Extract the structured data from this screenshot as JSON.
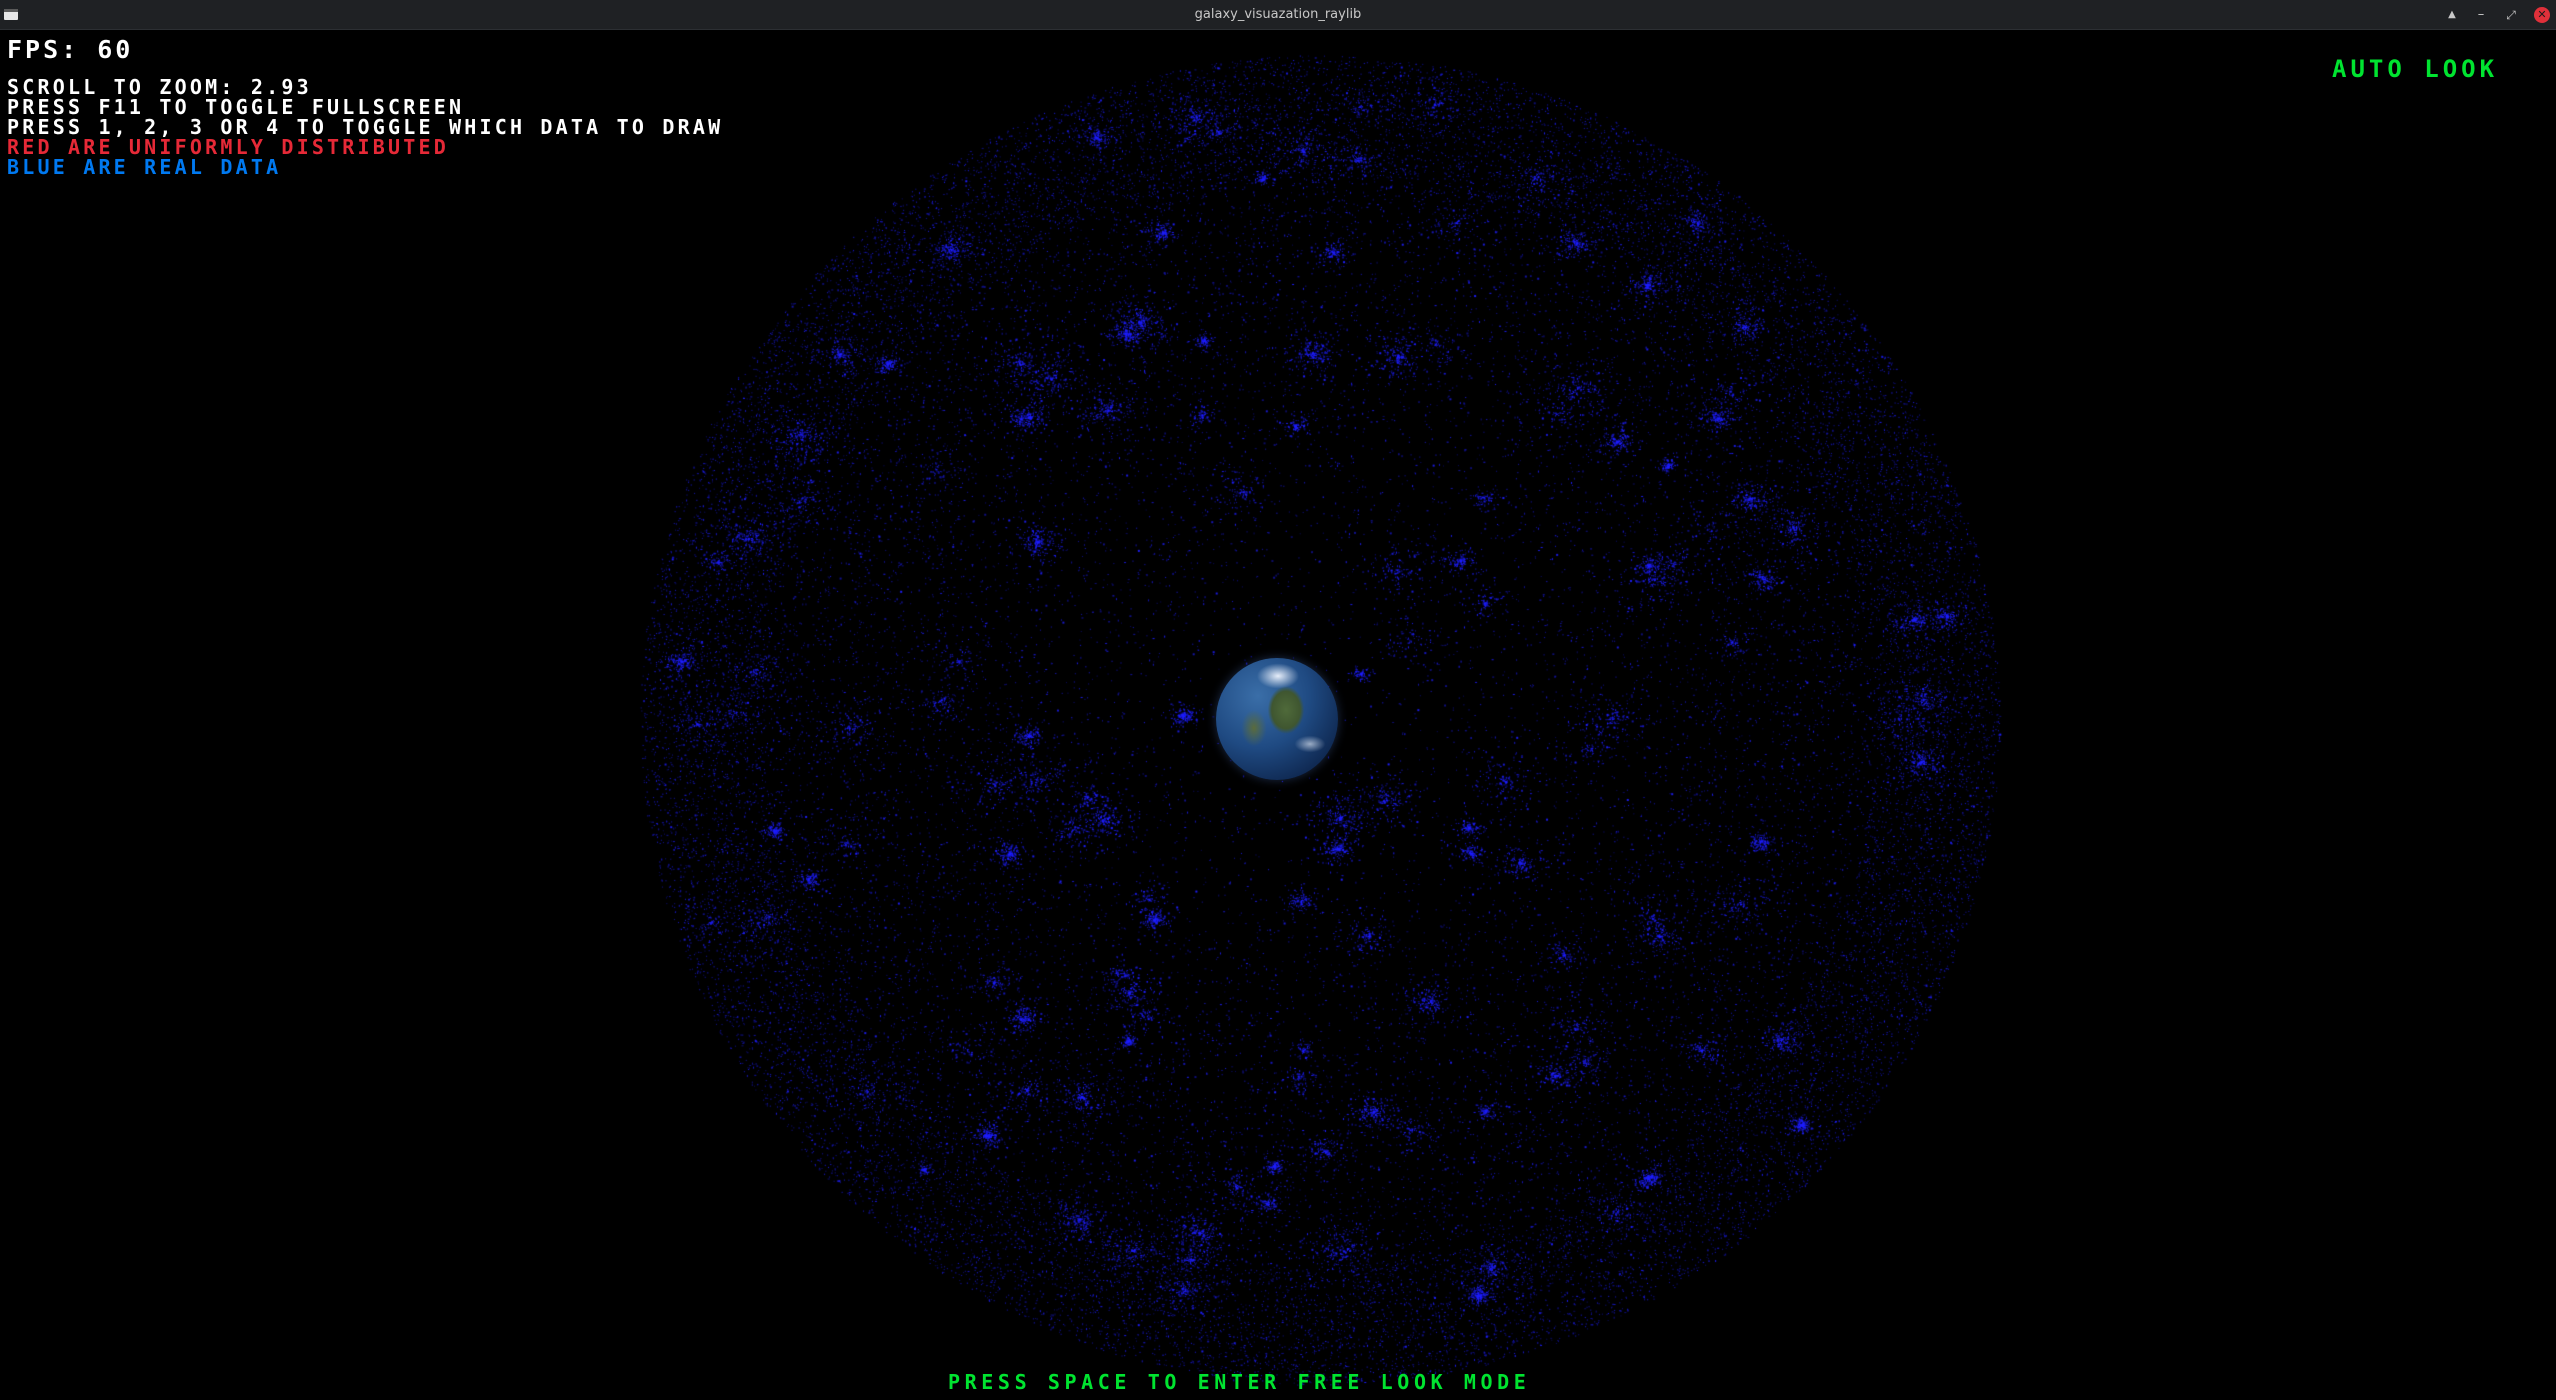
{
  "window": {
    "title": "galaxy_visuazation_raylib",
    "app_icon": "window-app-icon",
    "controls": {
      "keep_above_icon": "▲",
      "minimize_icon": "–",
      "maximize_icon": "⤢",
      "close_icon": "✕"
    }
  },
  "hud": {
    "fps": "FPS: 60",
    "zoom": "SCROLL TO ZOOM: 2.93",
    "fullscreen": "PRESS F11 TO TOGGLE FULLSCREEN",
    "data_toggle": "PRESS 1, 2, 3 OR 4 TO TOGGLE WHICH DATA TO DRAW",
    "red_legend": "RED ARE UNIFORMLY DISTRIBUTED",
    "blue_legend": "BLUE ARE REAL DATA",
    "mode": "AUTO LOOK",
    "mode_hint": "PRESS SPACE TO ENTER FREE LOOK MODE"
  },
  "colors": {
    "background": "#000000",
    "fps_text": "#ffffff",
    "instruction_text": "#ffffff",
    "red_legend": "#e62937",
    "blue_legend": "#0079f1",
    "mode_text": "#00e430",
    "stars": "#1e1eff"
  },
  "scene": {
    "earth_icon": "earth-globe",
    "stars_visible": "real-data"
  }
}
